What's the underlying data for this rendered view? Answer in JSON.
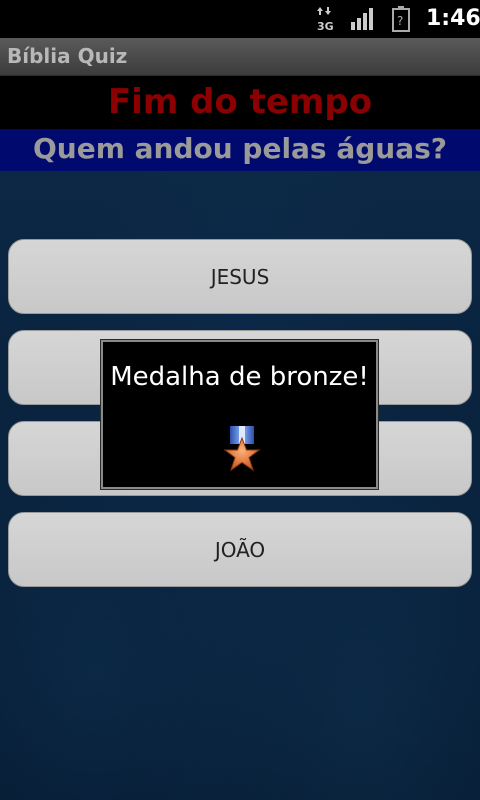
{
  "status_bar": {
    "network_label": "3G",
    "battery_label": "?",
    "time": "1:46"
  },
  "app": {
    "title": "Bíblia Quiz"
  },
  "quiz": {
    "timer_message": "Fim do tempo",
    "question": "Quem andou pelas águas?",
    "answers": [
      "JESUS",
      "",
      "",
      "JOÃO"
    ]
  },
  "dialog": {
    "title": "Medalha de bronze!",
    "icon": "bronze-medal-icon"
  },
  "colors": {
    "timer_text": "#8b0000",
    "question_bg": "#000a6e",
    "background": "#0a2440",
    "button_bg": "#d0d0d0"
  }
}
